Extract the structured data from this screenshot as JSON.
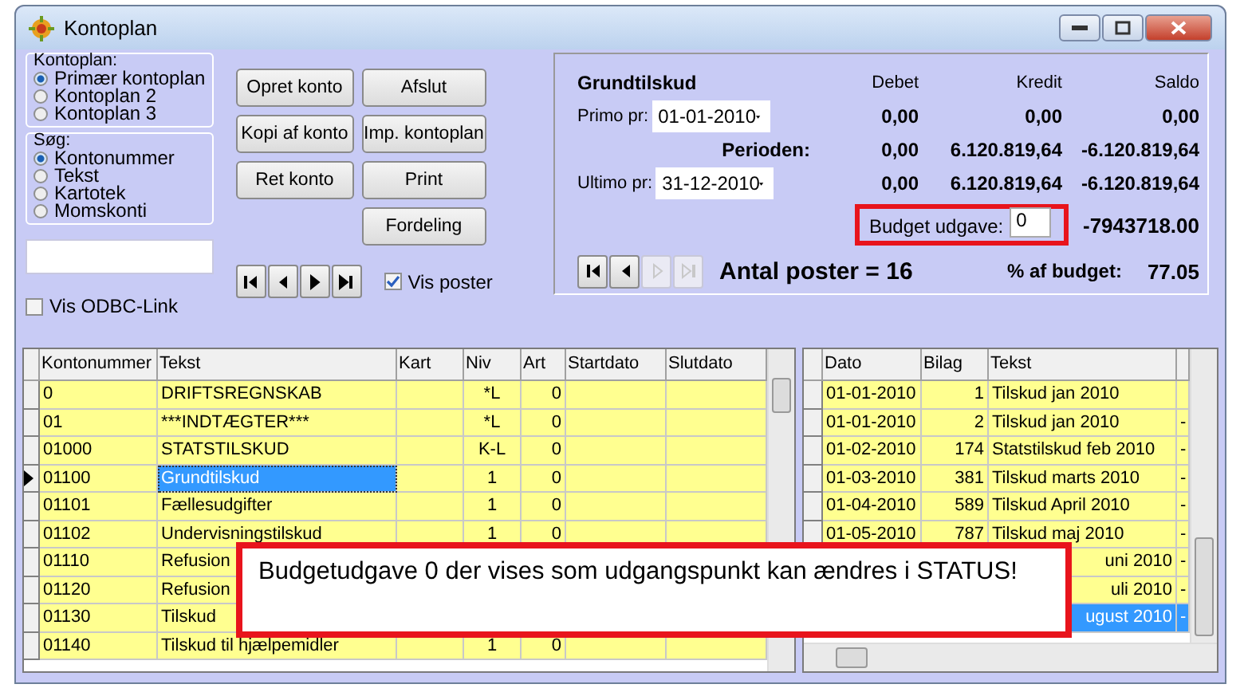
{
  "window": {
    "title": "Kontoplan"
  },
  "kontoplan_group": {
    "label": "Kontoplan:",
    "options": [
      {
        "label": "Primær kontoplan",
        "selected": true
      },
      {
        "label": "Kontoplan 2",
        "selected": false
      },
      {
        "label": "Kontoplan 3",
        "selected": false
      }
    ]
  },
  "search_group": {
    "label": "Søg:",
    "options": [
      {
        "label": "Kontonummer",
        "selected": true
      },
      {
        "label": "Tekst",
        "selected": false
      },
      {
        "label": "Kartotek",
        "selected": false
      },
      {
        "label": "Momskonti",
        "selected": false
      }
    ]
  },
  "buttons": [
    {
      "label": "Opret konto"
    },
    {
      "label": "Afslut"
    },
    {
      "label": "Kopi af konto"
    },
    {
      "label": "Imp. kontoplan"
    },
    {
      "label": "Ret konto"
    },
    {
      "label": "Print"
    },
    {
      "label": "Fordeling"
    }
  ],
  "account_nav": [
    {
      "kind": "first",
      "disabled": false
    },
    {
      "kind": "prev",
      "disabled": false
    },
    {
      "kind": "next",
      "disabled": false
    },
    {
      "kind": "last",
      "disabled": false
    }
  ],
  "vis_poster": {
    "label": "Vis poster",
    "checked": true
  },
  "odbc_link": {
    "label": "Vis ODBC-Link",
    "checked": false
  },
  "summary": {
    "title": "Grundtilskud",
    "headers": [
      "Debet",
      "Kredit",
      "Saldo"
    ],
    "primo": {
      "label": "Primo pr:",
      "date": "01-01-2010",
      "values": [
        "0,00",
        "0,00",
        "0,00"
      ]
    },
    "period": {
      "label": "Perioden:",
      "values": [
        "0,00",
        "6.120.819,64",
        "-6.120.819,64"
      ]
    },
    "ultimo": {
      "label": "Ultimo pr:",
      "date": "31-12-2010",
      "values": [
        "0,00",
        "6.120.819,64",
        "-6.120.819,64"
      ]
    },
    "budget": {
      "label": "Budget udgave:",
      "value": "0",
      "amount": "-7943718.00",
      "highlighted": true
    },
    "nav": [
      {
        "kind": "first",
        "disabled": false
      },
      {
        "kind": "prev",
        "disabled": false
      },
      {
        "kind": "next",
        "disabled": true
      },
      {
        "kind": "last",
        "disabled": true
      }
    ],
    "count": "Antal poster = 16",
    "percent_label": "% af budget:",
    "percent_value": "77.05"
  },
  "accounts": {
    "columns": [
      "Kontonummer",
      "Tekst",
      "Kart",
      "Niv",
      "Art",
      "Startdato",
      "Slutdato"
    ],
    "rows": [
      {
        "cells": [
          "0",
          "DRIFTSREGNSKAB",
          "",
          "*L",
          "0",
          "",
          ""
        ],
        "selected": false
      },
      {
        "cells": [
          "01",
          "***INDTÆGTER***",
          "",
          "*L",
          "0",
          "",
          ""
        ],
        "selected": false
      },
      {
        "cells": [
          "01000",
          "STATSTILSKUD",
          "",
          "K-L",
          "0",
          "",
          ""
        ],
        "selected": false
      },
      {
        "cells": [
          "01100",
          "Grundtilskud",
          "",
          "1",
          "0",
          "",
          ""
        ],
        "selected": true
      },
      {
        "cells": [
          "01101",
          "Fællesudgifter",
          "",
          "1",
          "0",
          "",
          ""
        ],
        "selected": false
      },
      {
        "cells": [
          "01102",
          "Undervisningstilskud",
          "",
          "1",
          "0",
          "",
          ""
        ],
        "selected": false
      },
      {
        "cells": [
          "01110",
          "Refusion",
          null,
          null,
          null,
          null,
          null
        ],
        "selected": false
      },
      {
        "cells": [
          "01120",
          "Refusion",
          null,
          null,
          null,
          null,
          null
        ],
        "selected": false
      },
      {
        "cells": [
          "01130",
          "Tilskud",
          null,
          null,
          null,
          null,
          null
        ],
        "selected": false
      },
      {
        "cells": [
          "01140",
          "Tilskud til hjælpemidler",
          "",
          "1",
          "0",
          "",
          ""
        ],
        "selected": false
      }
    ]
  },
  "postings": {
    "columns": [
      "Dato",
      "Bilag",
      "Tekst"
    ],
    "rows": [
      {
        "cells": [
          "01-01-2010",
          "1",
          "Tilskud jan 2010",
          ""
        ],
        "selected": false
      },
      {
        "cells": [
          "01-01-2010",
          "2",
          "Tilskud jan 2010",
          "-"
        ],
        "selected": false
      },
      {
        "cells": [
          "01-02-2010",
          "174",
          "Statstilskud feb 2010",
          "-"
        ],
        "selected": false
      },
      {
        "cells": [
          "01-03-2010",
          "381",
          "Tilskud marts 2010",
          "-"
        ],
        "selected": false
      },
      {
        "cells": [
          "01-04-2010",
          "589",
          "Tilskud April 2010",
          "-"
        ],
        "selected": false
      },
      {
        "cells": [
          "01-05-2010",
          "787",
          "Tilskud maj 2010",
          "-"
        ],
        "selected": false
      },
      {
        "cells": [
          null,
          null,
          "uni 2010",
          "-"
        ],
        "selected": false
      },
      {
        "cells": [
          null,
          null,
          "uli 2010",
          "-"
        ],
        "selected": false
      },
      {
        "cells": [
          null,
          null,
          "ugust 2010",
          "-"
        ],
        "selected": true
      }
    ]
  },
  "callout": {
    "text": "Budgetudgave 0 der vises som udgangspunkt kan ændres i STATUS!"
  }
}
